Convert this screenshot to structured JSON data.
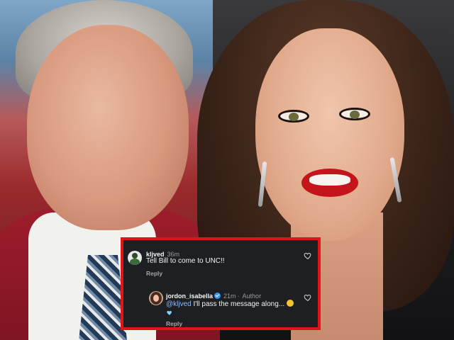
{
  "comments": [
    {
      "username": "kljved",
      "time": "36m",
      "text": "Tell Bill to come to UNC!!",
      "reply_label": "Reply",
      "like_icon": "heart-outline-icon"
    },
    {
      "username": "jordon_isabella",
      "time": "21m",
      "author_tag": "Author",
      "mention": "@kljved",
      "text": " I'll pass the message along...",
      "reply_label": "Reply",
      "like_icon": "heart-outline-icon",
      "emoji": "smile-emoji-icon",
      "emoji_heart": "blue-heart-emoji-icon"
    }
  ],
  "colors": {
    "card_bg": "#1d1f22",
    "card_border": "#e01515",
    "mention": "#8fb8ff",
    "verified": "#3897f0"
  }
}
